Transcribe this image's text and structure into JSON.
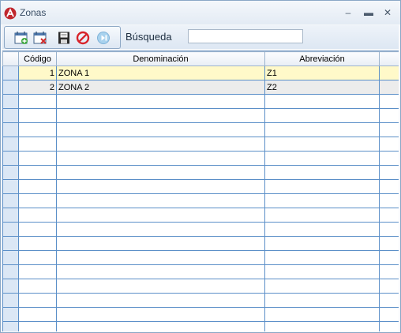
{
  "window": {
    "title": "Zonas",
    "minimize": "–",
    "maximize": "▬",
    "close": "✕"
  },
  "toolbar": {
    "icons": [
      "add-record-icon",
      "delete-record-icon",
      "save-icon",
      "cancel-icon",
      "next-icon"
    ],
    "search_label": "Búsqueda",
    "search_value": ""
  },
  "grid": {
    "columns": [
      "Código",
      "Denominación",
      "Abreviación"
    ],
    "rows": [
      {
        "code": "1",
        "name": "ZONA 1",
        "abbr": "Z1"
      },
      {
        "code": "2",
        "name": "ZONA 2",
        "abbr": "Z2"
      }
    ],
    "empty_rows": 17
  },
  "colors": {
    "selected_row": "#fff9c9",
    "alt_row": "#ececec",
    "grid_line": "#5b8fc8",
    "indicator": "#dbe7f5"
  }
}
